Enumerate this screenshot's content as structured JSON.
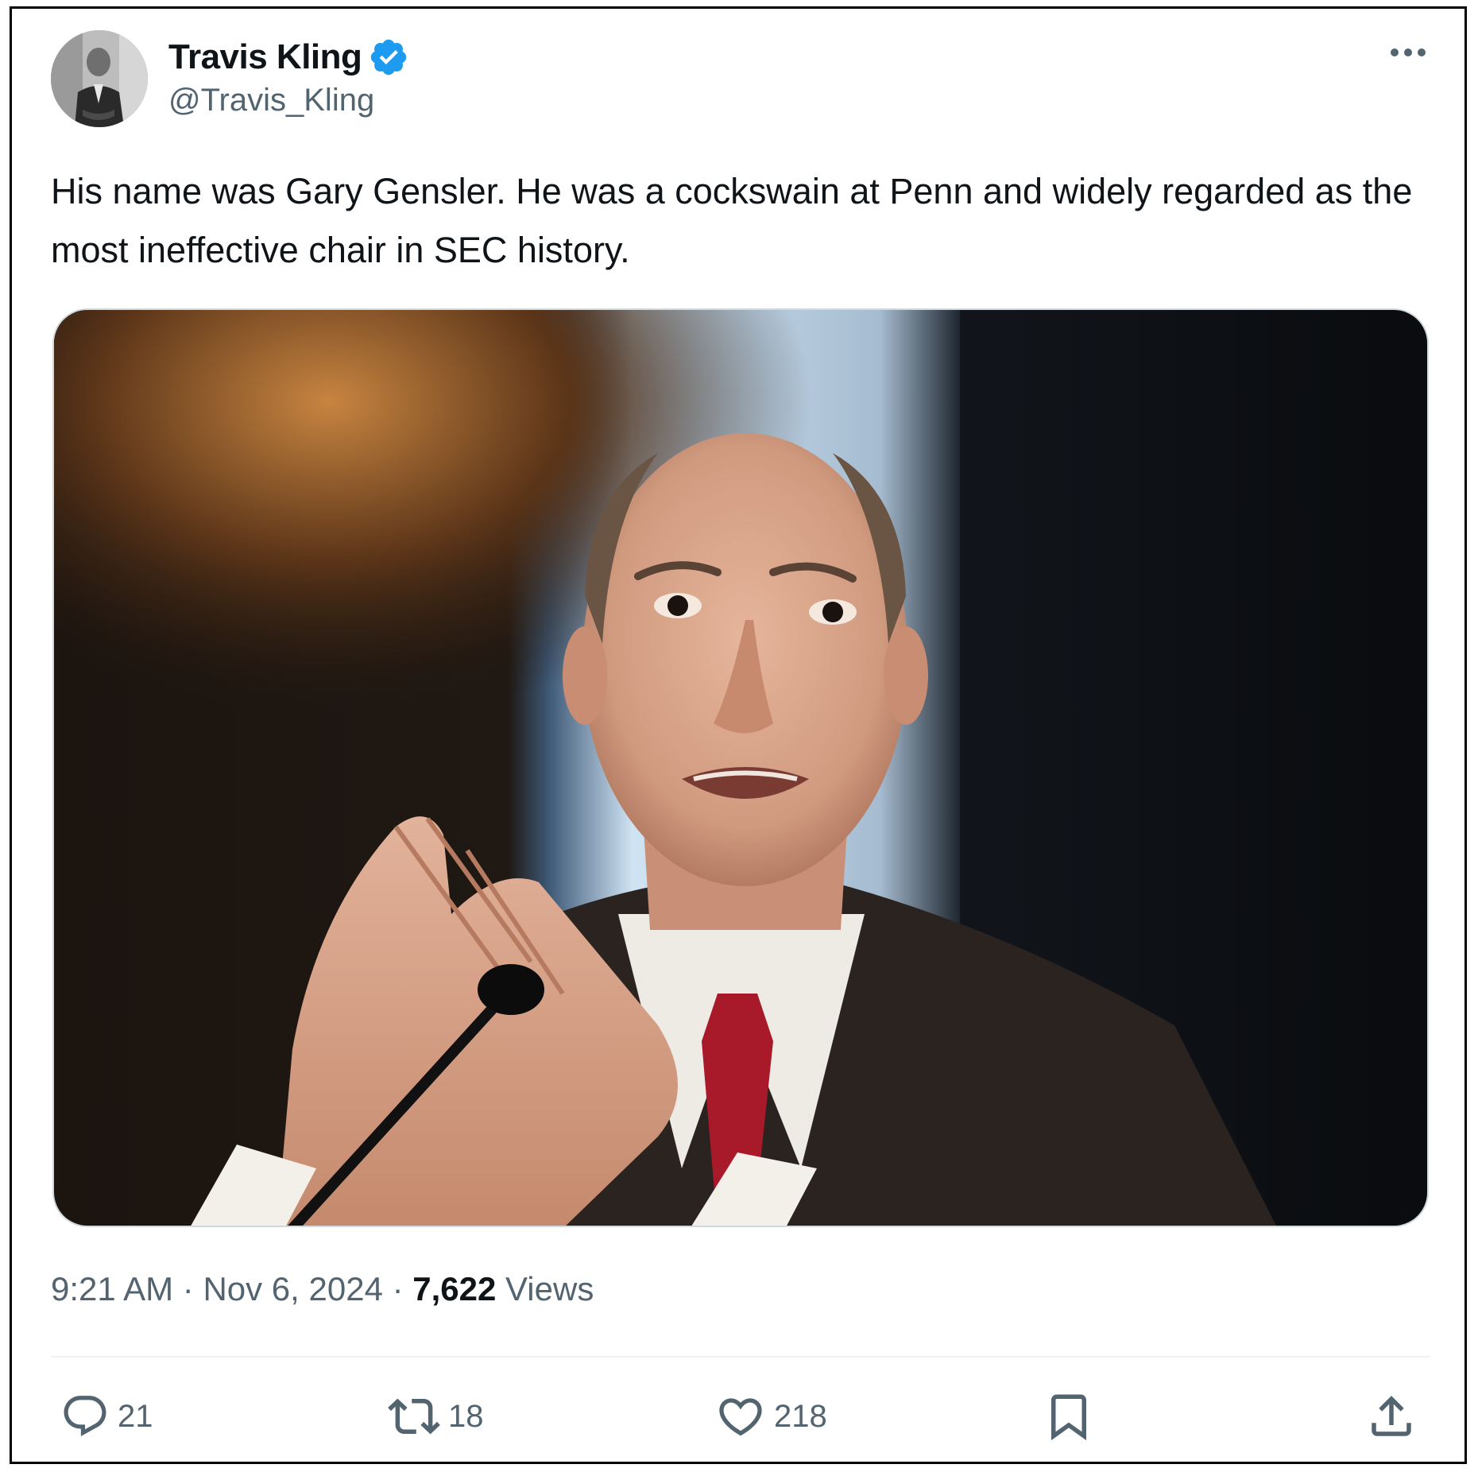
{
  "author": {
    "display_name": "Travis Kling",
    "handle": "@Travis_Kling",
    "verified": true
  },
  "tweet": {
    "text": "His name was Gary Gensler. He was a cockswain at Penn and widely regarded as the most ineffective chair in SEC history."
  },
  "meta": {
    "time": "9:21 AM",
    "separator": " · ",
    "date": "Nov 6, 2024",
    "views_count": "7,622",
    "views_label": "Views"
  },
  "actions": {
    "replies": "21",
    "reposts": "18",
    "likes": "218"
  },
  "icons": {
    "verified": "verified-badge-icon",
    "more": "more-dots-icon",
    "reply": "reply-icon",
    "repost": "repost-icon",
    "like": "heart-icon",
    "bookmark": "bookmark-icon",
    "share": "share-icon"
  },
  "colors": {
    "text_primary": "#0f1419",
    "text_secondary": "#536471",
    "verified_blue": "#1d9bf0",
    "divider": "#eff3f4"
  }
}
